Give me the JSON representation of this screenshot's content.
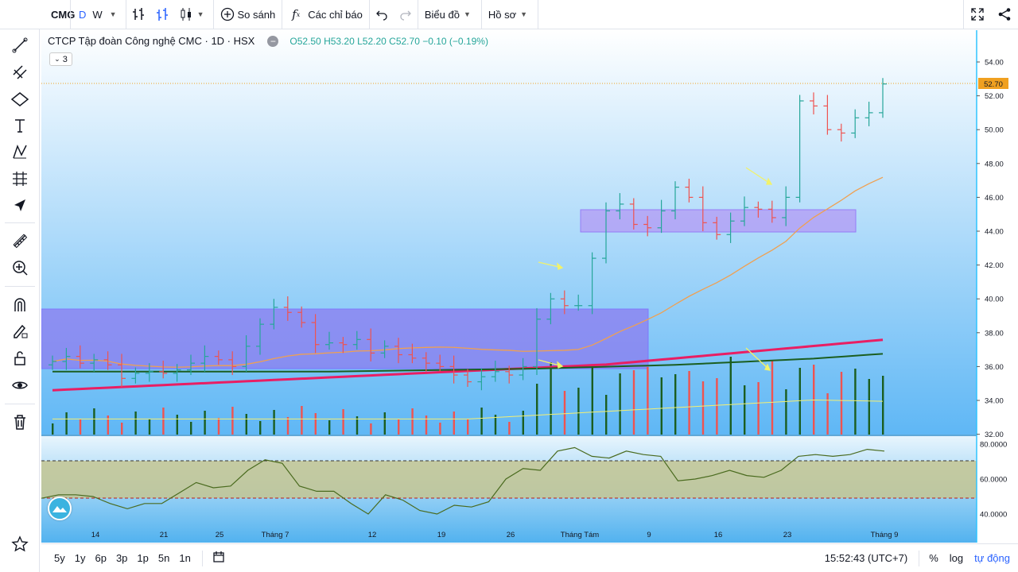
{
  "toolbar": {
    "symbol": "CMG",
    "interval_d": "D",
    "interval_w": "W",
    "compare_label": "So sánh",
    "indicators_label": "Các chỉ báo",
    "chart_label": "Biểu đồ",
    "profile_label": "Hồ sơ"
  },
  "legend": {
    "title": "CTCP Tập đoàn Công nghệ CMC · 1D · HSX",
    "open": "O52.50",
    "high": "H53.20",
    "low": "L52.20",
    "close": "C52.70",
    "change": "−0.10 (−0.19%)",
    "collapsed_count": "3"
  },
  "price_axis": {
    "ticks": [
      "54.00",
      "52.00",
      "50.00",
      "48.00",
      "46.00",
      "44.00",
      "42.00",
      "40.00",
      "38.00",
      "36.00",
      "34.00",
      "32.00"
    ],
    "last_price": "52.70"
  },
  "osc_axis": {
    "ticks": [
      "80.0000",
      "60.0000",
      "40.0000"
    ]
  },
  "time_axis": {
    "labels": [
      "14",
      "21",
      "25",
      "Tháng 7",
      "12",
      "19",
      "26",
      "Tháng Tám",
      "9",
      "16",
      "23",
      "Tháng 9"
    ]
  },
  "bottom": {
    "ranges": [
      "5y",
      "1y",
      "6p",
      "3p",
      "1p",
      "5n",
      "1n"
    ],
    "clock": "15:52:43 (UTC+7)",
    "percent": "%",
    "log": "log",
    "auto": "tự động"
  },
  "colors": {
    "up": "#26a69a",
    "down": "#ef5350",
    "ma_fast": "#f0a050",
    "ma_mid": "#1b5e20",
    "ma_slow": "#e91e63",
    "zone": "#8c7cf0",
    "background_top": "#ffffff",
    "background_bottom": "#5fb7f5"
  },
  "icons": {
    "left_tools": [
      "crosshair-icon",
      "trendline-icon",
      "fib-icon",
      "shapes-icon",
      "text-icon",
      "pattern-icon",
      "prediction-icon",
      "arrow-icon",
      "ruler-icon",
      "zoom-icon",
      "magnet-icon",
      "lock-draw-icon",
      "lock-icon",
      "eye-icon",
      "trash-icon",
      "star-icon"
    ]
  },
  "chart_data": [
    {
      "type": "line",
      "title": "",
      "x": [
        "Jun 10",
        "Jun 11",
        "Jun 12",
        "Jun 13",
        "Jun 14",
        "Jun 17",
        "Jun 18",
        "Jun 19",
        "Jun 20",
        "Jun 21",
        "Jun 24",
        "Jun 25",
        "Jun 26",
        "Jun 27",
        "Jun 28",
        "Jul 1",
        "Jul 2",
        "Jul 3",
        "Jul 4",
        "Jul 5",
        "Jul 8",
        "Jul 9",
        "Jul 10",
        "Jul 11",
        "Jul 12",
        "Jul 15",
        "Jul 16",
        "Jul 17",
        "Jul 18",
        "Jul 19",
        "Jul 22",
        "Jul 23",
        "Jul 24",
        "Jul 25",
        "Jul 26",
        "Jul 29",
        "Jul 30",
        "Jul 31",
        "Aug 1",
        "Aug 2",
        "Aug 5",
        "Aug 6",
        "Aug 7",
        "Aug 8",
        "Aug 9",
        "Aug 12",
        "Aug 13",
        "Aug 14",
        "Aug 15",
        "Aug 16",
        "Aug 19",
        "Aug 20",
        "Aug 21",
        "Aug 22",
        "Aug 23",
        "Aug 26",
        "Aug 27",
        "Aug 28",
        "Aug 29",
        "Aug 30",
        "Sep 3"
      ],
      "series": [
        {
          "values": [
            36.3,
            36.6,
            36.2,
            36.4,
            36.1,
            35.3,
            35.6,
            35.7,
            35.6,
            35.8,
            36.2,
            36.6,
            36.4,
            36.0,
            37.2,
            38.5,
            39.5,
            39.2,
            38.6,
            37.3,
            37.4,
            37.3,
            37.6,
            36.8,
            37.2,
            36.7,
            36.5,
            36.2,
            36.0,
            35.5,
            35.1,
            35.4,
            35.7,
            35.5,
            36.0,
            38.8,
            40.0,
            39.6,
            39.6,
            42.4,
            45.2,
            45.6,
            44.4,
            44.2,
            45.2,
            46.6,
            46.0,
            44.5,
            43.8,
            44.6,
            45.4,
            45.3,
            44.8,
            46.0,
            51.7,
            51.4,
            50.0,
            49.8,
            50.7,
            51.0,
            52.7
          ]
        }
      ],
      "ylim": [
        32,
        55
      ]
    },
    {
      "type": "line",
      "title": "",
      "series": [
        {
          "values": [
            49,
            51,
            51,
            50,
            46,
            43,
            46,
            46,
            52,
            58,
            55,
            56,
            65,
            71,
            69,
            56,
            53,
            53,
            46,
            40,
            51,
            48,
            42,
            40,
            45,
            44,
            47,
            60,
            66,
            65,
            76,
            78,
            73,
            72,
            76,
            74,
            73,
            59,
            60,
            62,
            65,
            62,
            61,
            65,
            73,
            74,
            73,
            74,
            77,
            76
          ]
        }
      ],
      "ylim": [
        35,
        85
      ]
    }
  ]
}
